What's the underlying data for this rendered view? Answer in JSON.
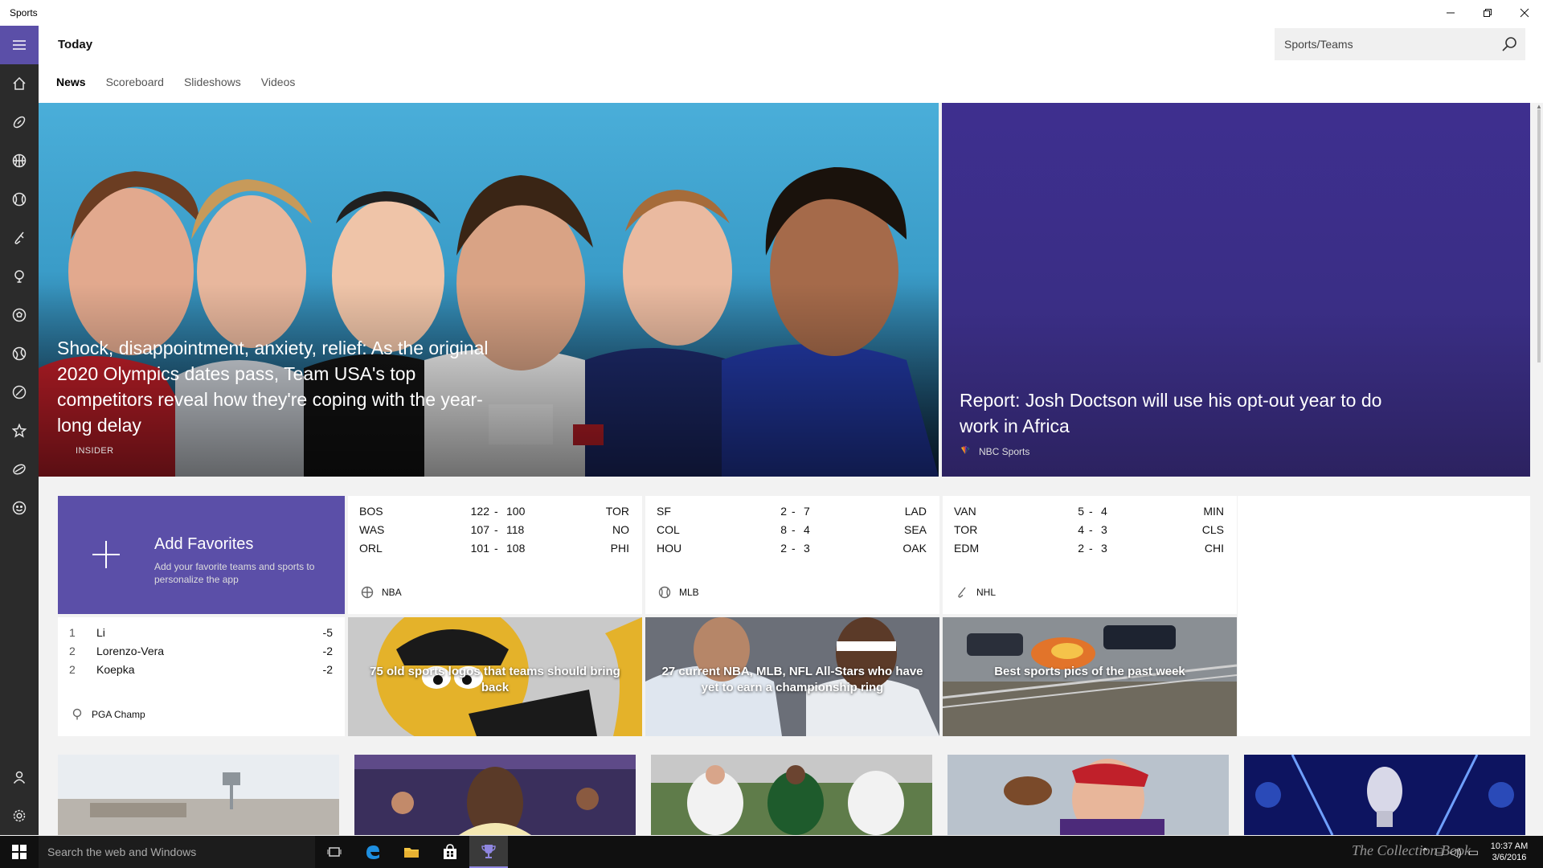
{
  "window": {
    "app_name": "Sports"
  },
  "header": {
    "title": "Today",
    "search_placeholder": "Sports/Teams",
    "tabs": [
      {
        "label": "News",
        "active": true
      },
      {
        "label": "Scoreboard",
        "active": false
      },
      {
        "label": "Slideshows",
        "active": false
      },
      {
        "label": "Videos",
        "active": false
      }
    ]
  },
  "nav": {
    "items": [
      "home-icon",
      "football-icon",
      "basketball-icon",
      "baseball-icon",
      "hockey-icon",
      "golf-icon",
      "soccer-icon",
      "tennis-icon",
      "cricket-icon",
      "favorites-icon",
      "rugby-icon",
      "fantasy-icon"
    ],
    "bottom": [
      "account-icon",
      "settings-icon"
    ]
  },
  "hero": {
    "headline": "Shock, disappointment, anxiety, relief: As the original 2020 Olympics dates pass, Team USA's top competitors reveal how they're coping with the year-long delay",
    "source": "INSIDER"
  },
  "feature": {
    "headline": "Report: Josh Doctson will use his opt-out year to do work in Africa",
    "source": "NBC Sports"
  },
  "favorites": {
    "title": "Add Favorites",
    "description": "Add your favorite teams and sports to personalize the app"
  },
  "scoreboards": [
    {
      "league": "NBA",
      "games": [
        {
          "away": "BOS",
          "away_score": "122",
          "home_score": "100",
          "home": "TOR"
        },
        {
          "away": "WAS",
          "away_score": "107",
          "home_score": "118",
          "home": "NO"
        },
        {
          "away": "ORL",
          "away_score": "101",
          "home_score": "108",
          "home": "PHI"
        }
      ]
    },
    {
      "league": "MLB",
      "games": [
        {
          "away": "SF",
          "away_score": "2",
          "home_score": "7",
          "home": "LAD"
        },
        {
          "away": "COL",
          "away_score": "8",
          "home_score": "4",
          "home": "SEA"
        },
        {
          "away": "HOU",
          "away_score": "2",
          "home_score": "3",
          "home": "OAK"
        }
      ]
    },
    {
      "league": "NHL",
      "games": [
        {
          "away": "VAN",
          "away_score": "5",
          "home_score": "4",
          "home": "MIN"
        },
        {
          "away": "TOR",
          "away_score": "4",
          "home_score": "3",
          "home": "CLS"
        },
        {
          "away": "EDM",
          "away_score": "2",
          "home_score": "3",
          "home": "CHI"
        }
      ]
    }
  ],
  "golf": {
    "event": "PGA Champ",
    "leaders": [
      {
        "pos": "1",
        "name": "Li",
        "score": "-5"
      },
      {
        "pos": "2",
        "name": "Lorenzo-Vera",
        "score": "-2"
      },
      {
        "pos": "2",
        "name": "Koepka",
        "score": "-2"
      }
    ]
  },
  "stories": [
    {
      "caption": "75 old sports logos that teams should bring back"
    },
    {
      "caption": "27 current NBA, MLB, NFL All-Stars who have yet to earn a championship ring"
    },
    {
      "caption": "Best sports pics of the past week"
    }
  ],
  "taskbar": {
    "search_placeholder": "Search the web and Windows",
    "time": "10:37 AM",
    "date": "3/6/2016",
    "watermark": "The Collection Book"
  },
  "colors": {
    "accent": "#5b4fa8",
    "rail": "#2b2b2b",
    "taskbar": "#101010"
  }
}
